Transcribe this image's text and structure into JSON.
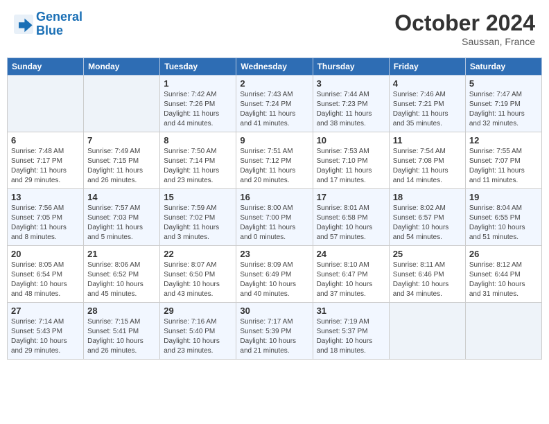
{
  "header": {
    "logo_line1": "General",
    "logo_line2": "Blue",
    "month": "October 2024",
    "location": "Saussan, France"
  },
  "days_of_week": [
    "Sunday",
    "Monday",
    "Tuesday",
    "Wednesday",
    "Thursday",
    "Friday",
    "Saturday"
  ],
  "weeks": [
    [
      {
        "day": "",
        "info": ""
      },
      {
        "day": "",
        "info": ""
      },
      {
        "day": "1",
        "info": "Sunrise: 7:42 AM\nSunset: 7:26 PM\nDaylight: 11 hours and 44 minutes."
      },
      {
        "day": "2",
        "info": "Sunrise: 7:43 AM\nSunset: 7:24 PM\nDaylight: 11 hours and 41 minutes."
      },
      {
        "day": "3",
        "info": "Sunrise: 7:44 AM\nSunset: 7:23 PM\nDaylight: 11 hours and 38 minutes."
      },
      {
        "day": "4",
        "info": "Sunrise: 7:46 AM\nSunset: 7:21 PM\nDaylight: 11 hours and 35 minutes."
      },
      {
        "day": "5",
        "info": "Sunrise: 7:47 AM\nSunset: 7:19 PM\nDaylight: 11 hours and 32 minutes."
      }
    ],
    [
      {
        "day": "6",
        "info": "Sunrise: 7:48 AM\nSunset: 7:17 PM\nDaylight: 11 hours and 29 minutes."
      },
      {
        "day": "7",
        "info": "Sunrise: 7:49 AM\nSunset: 7:15 PM\nDaylight: 11 hours and 26 minutes."
      },
      {
        "day": "8",
        "info": "Sunrise: 7:50 AM\nSunset: 7:14 PM\nDaylight: 11 hours and 23 minutes."
      },
      {
        "day": "9",
        "info": "Sunrise: 7:51 AM\nSunset: 7:12 PM\nDaylight: 11 hours and 20 minutes."
      },
      {
        "day": "10",
        "info": "Sunrise: 7:53 AM\nSunset: 7:10 PM\nDaylight: 11 hours and 17 minutes."
      },
      {
        "day": "11",
        "info": "Sunrise: 7:54 AM\nSunset: 7:08 PM\nDaylight: 11 hours and 14 minutes."
      },
      {
        "day": "12",
        "info": "Sunrise: 7:55 AM\nSunset: 7:07 PM\nDaylight: 11 hours and 11 minutes."
      }
    ],
    [
      {
        "day": "13",
        "info": "Sunrise: 7:56 AM\nSunset: 7:05 PM\nDaylight: 11 hours and 8 minutes."
      },
      {
        "day": "14",
        "info": "Sunrise: 7:57 AM\nSunset: 7:03 PM\nDaylight: 11 hours and 5 minutes."
      },
      {
        "day": "15",
        "info": "Sunrise: 7:59 AM\nSunset: 7:02 PM\nDaylight: 11 hours and 3 minutes."
      },
      {
        "day": "16",
        "info": "Sunrise: 8:00 AM\nSunset: 7:00 PM\nDaylight: 11 hours and 0 minutes."
      },
      {
        "day": "17",
        "info": "Sunrise: 8:01 AM\nSunset: 6:58 PM\nDaylight: 10 hours and 57 minutes."
      },
      {
        "day": "18",
        "info": "Sunrise: 8:02 AM\nSunset: 6:57 PM\nDaylight: 10 hours and 54 minutes."
      },
      {
        "day": "19",
        "info": "Sunrise: 8:04 AM\nSunset: 6:55 PM\nDaylight: 10 hours and 51 minutes."
      }
    ],
    [
      {
        "day": "20",
        "info": "Sunrise: 8:05 AM\nSunset: 6:54 PM\nDaylight: 10 hours and 48 minutes."
      },
      {
        "day": "21",
        "info": "Sunrise: 8:06 AM\nSunset: 6:52 PM\nDaylight: 10 hours and 45 minutes."
      },
      {
        "day": "22",
        "info": "Sunrise: 8:07 AM\nSunset: 6:50 PM\nDaylight: 10 hours and 43 minutes."
      },
      {
        "day": "23",
        "info": "Sunrise: 8:09 AM\nSunset: 6:49 PM\nDaylight: 10 hours and 40 minutes."
      },
      {
        "day": "24",
        "info": "Sunrise: 8:10 AM\nSunset: 6:47 PM\nDaylight: 10 hours and 37 minutes."
      },
      {
        "day": "25",
        "info": "Sunrise: 8:11 AM\nSunset: 6:46 PM\nDaylight: 10 hours and 34 minutes."
      },
      {
        "day": "26",
        "info": "Sunrise: 8:12 AM\nSunset: 6:44 PM\nDaylight: 10 hours and 31 minutes."
      }
    ],
    [
      {
        "day": "27",
        "info": "Sunrise: 7:14 AM\nSunset: 5:43 PM\nDaylight: 10 hours and 29 minutes."
      },
      {
        "day": "28",
        "info": "Sunrise: 7:15 AM\nSunset: 5:41 PM\nDaylight: 10 hours and 26 minutes."
      },
      {
        "day": "29",
        "info": "Sunrise: 7:16 AM\nSunset: 5:40 PM\nDaylight: 10 hours and 23 minutes."
      },
      {
        "day": "30",
        "info": "Sunrise: 7:17 AM\nSunset: 5:39 PM\nDaylight: 10 hours and 21 minutes."
      },
      {
        "day": "31",
        "info": "Sunrise: 7:19 AM\nSunset: 5:37 PM\nDaylight: 10 hours and 18 minutes."
      },
      {
        "day": "",
        "info": ""
      },
      {
        "day": "",
        "info": ""
      }
    ]
  ]
}
